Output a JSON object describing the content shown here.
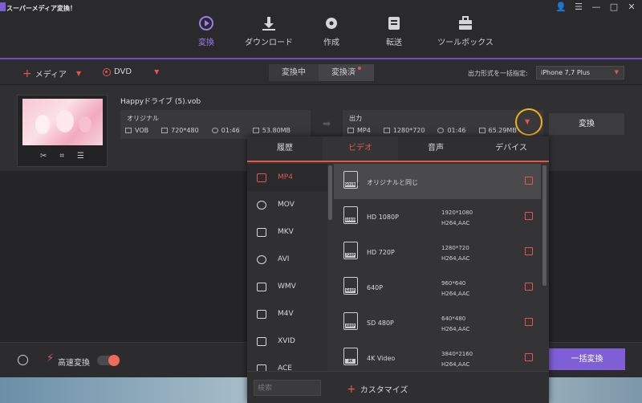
{
  "app": {
    "title": "スーパーメディア変換！"
  },
  "nav": [
    {
      "label": "変換",
      "icon": "play-circle-icon"
    },
    {
      "label": "ダウンロード",
      "icon": "download-icon"
    },
    {
      "label": "作成",
      "icon": "disc-icon"
    },
    {
      "label": "転送",
      "icon": "transfer-icon"
    },
    {
      "label": "ツールボックス",
      "icon": "toolbox-icon"
    }
  ],
  "toolbar": {
    "add_media": "メディア",
    "dvd": "DVD",
    "seg_converting": "変換中",
    "seg_converted": "変換済",
    "format_label": "出力形式を一括指定:",
    "format_value": "iPhone 7,7 Plus"
  },
  "file": {
    "name": "Happyドライブ (5).vob",
    "original": {
      "title": "オリジナル",
      "format": "VOB",
      "resolution": "720*480",
      "duration": "01:46",
      "size": "53.80MB"
    },
    "output": {
      "title": "出力",
      "format": "MP4",
      "resolution": "1280*720",
      "duration": "01:46",
      "size": "65.29MB"
    },
    "convert_label": "変換"
  },
  "panel": {
    "tabs": [
      "履歴",
      "ビデオ",
      "音声",
      "デバイス"
    ],
    "formats": [
      "MP4",
      "MOV",
      "MKV",
      "AVI",
      "WMV",
      "M4V",
      "XVID",
      "ACE"
    ],
    "presets": [
      {
        "name": "オリジナルと同じ",
        "tag": "SOURCE",
        "res": "",
        "codec": ""
      },
      {
        "name": "HD 1080P",
        "tag": "1080P",
        "res": "1920*1080",
        "codec": "H264,AAC"
      },
      {
        "name": "HD 720P",
        "tag": "720P",
        "res": "1280*720",
        "codec": "H264,AAC"
      },
      {
        "name": "640P",
        "tag": "640P",
        "res": "960*640",
        "codec": "H264,AAC"
      },
      {
        "name": "SD 480P",
        "tag": "480P",
        "res": "640*480",
        "codec": "H264,AAC"
      },
      {
        "name": "4K Video",
        "tag": "4K",
        "res": "3840*2160",
        "codec": "H264,AAC"
      }
    ],
    "search_placeholder": "検索",
    "customize": "カスタマイズ"
  },
  "bottom": {
    "speed_label": "高速変換",
    "batch_convert": "一括変換"
  },
  "colors": {
    "accent": "#7e5fd6",
    "highlight": "#e2574c",
    "callout": "#f0b01f"
  }
}
